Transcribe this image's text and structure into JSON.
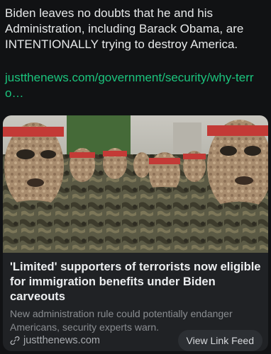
{
  "post": {
    "text": "Biden leaves no doubts that he and his Administration, including Barack Obama, are INTENTIONALLY trying to destroy America.",
    "link_text": "justthenews.com/government/security/why-terro…"
  },
  "card": {
    "image_alt": "Masked fighters in camouflage uniforms wearing red headbands",
    "title": "'Limited' supporters of terrorists now eligible for immigration benefits under Biden carveouts",
    "description": "New administration rule could potentially endanger Americans, security experts warn.",
    "domain": "justthenews.com",
    "feed_button": "View Link Feed",
    "link_icon": "link-icon"
  }
}
